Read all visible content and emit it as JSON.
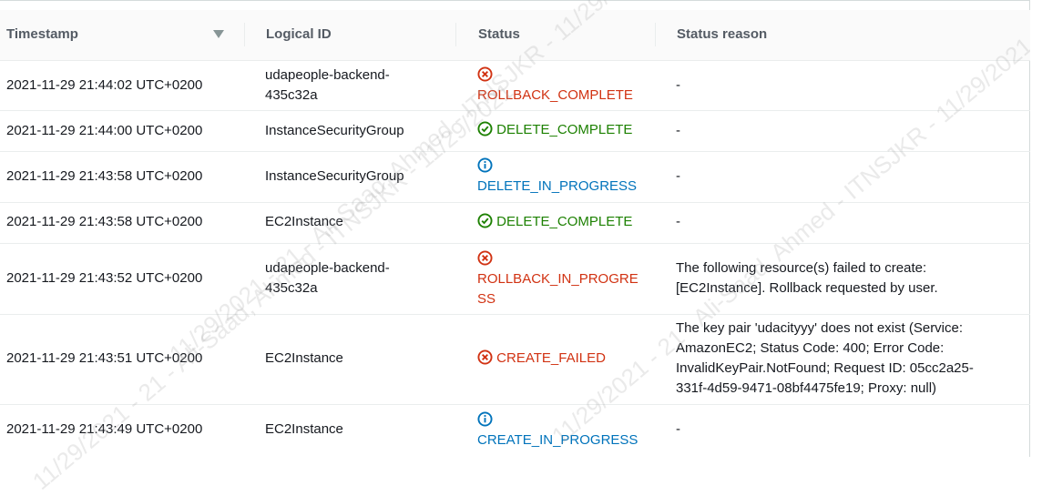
{
  "columns": {
    "timestamp": "Timestamp",
    "logical_id": "Logical ID",
    "status": "Status",
    "status_reason": "Status reason"
  },
  "rows": [
    {
      "timestamp": "2021-11-29 21:44:02 UTC+0200",
      "logical_id_l1": "udapeople-backend-",
      "logical_id_l2": "435c32a",
      "status": "ROLLBACK_COMPLETE",
      "status_kind": "error",
      "reason": "-"
    },
    {
      "timestamp": "2021-11-29 21:44:00 UTC+0200",
      "logical_id": "InstanceSecurityGroup",
      "status": "DELETE_COMPLETE",
      "status_kind": "success",
      "reason": "-"
    },
    {
      "timestamp": "2021-11-29 21:43:58 UTC+0200",
      "logical_id": "InstanceSecurityGroup",
      "status": "DELETE_IN_PROGRESS",
      "status_kind": "info",
      "reason": "-"
    },
    {
      "timestamp": "2021-11-29 21:43:58 UTC+0200",
      "logical_id": "EC2Instance",
      "status": "DELETE_COMPLETE",
      "status_kind": "success",
      "reason": "-"
    },
    {
      "timestamp": "2021-11-29 21:43:52 UTC+0200",
      "logical_id_l1": "udapeople-backend-",
      "logical_id_l2": "435c32a",
      "status_l1": "ROLLBACK_IN_PROGRE",
      "status_l2": "SS",
      "status_kind": "error",
      "reason_l1": "The following resource(s) failed to create:",
      "reason_l2": "[EC2Instance]. Rollback requested by user."
    },
    {
      "timestamp": "2021-11-29 21:43:51 UTC+0200",
      "logical_id": "EC2Instance",
      "status": "CREATE_FAILED",
      "status_kind": "error",
      "reason_l1": "The key pair 'udacityyy' does not exist (Service:",
      "reason_l2": "AmazonEC2; Status Code: 400; Error Code:",
      "reason_l3": "InvalidKeyPair.NotFound; Request ID: 05cc2a25-",
      "reason_l4": "331f-4d59-9471-08bf4475fe19; Proxy: null)"
    },
    {
      "timestamp": "2021-11-29 21:43:49 UTC+0200",
      "logical_id": "EC2Instance",
      "status": "CREATE_IN_PROGRESS",
      "status_kind": "info",
      "reason": "-"
    }
  ],
  "watermark": {
    "w1": "11/29/2021 - 21 - Ali-Saad, Ahmed - ITNSJKR - 11/29/2021",
    "w2": "11/29/2021 - 21 - Ali-Saad, Ahmed - ITNSJKR - 11/29/2021 - 21 - Ali-Saad, Ahmed",
    "w3": "11/29/2021 - 21 - Ali-Saad, Ahmed - ITNSJKR - 11/29/2021 - 21 - Ali-Saad, Ahmed"
  },
  "colors": {
    "error": "#d13212",
    "success": "#1d8102",
    "info": "#0073bb"
  },
  "icons": {
    "error": "error-x-circle-icon",
    "success": "success-check-circle-icon",
    "info": "info-circle-icon"
  }
}
